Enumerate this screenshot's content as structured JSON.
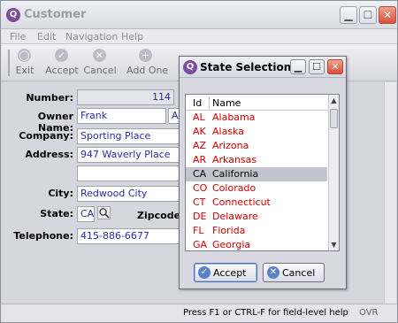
{
  "window": {
    "title": "Customer",
    "app_icon": "q-logo-icon",
    "controls": {
      "minimize_glyph": "▁",
      "maximize_glyph": "☐",
      "close_glyph": "✕"
    }
  },
  "menu": [
    "File",
    "Edit",
    "Navigation",
    "Help"
  ],
  "toolbar": [
    {
      "label": "Exit",
      "icon": "exit-icon",
      "glyph": "◯"
    },
    {
      "label": "Accept",
      "icon": "accept-icon",
      "glyph": "✓"
    },
    {
      "label": "Cancel",
      "icon": "cancel-icon",
      "glyph": "✕"
    },
    {
      "label": "Add One",
      "icon": "add-icon",
      "glyph": "+"
    }
  ],
  "form": {
    "number_label": "Number:",
    "number_value": "114",
    "owner_label": "Owner Name:",
    "owner_first": "Frank",
    "owner_last_initial": "A",
    "company_label": "Company:",
    "company_value": "Sporting Place",
    "address_label": "Address:",
    "address1_value": "947 Waverly Place",
    "address2_value": "",
    "city_label": "City:",
    "city_value": "Redwood City",
    "state_label": "State:",
    "state_value": "CA",
    "zipcode_label": "Zipcode:",
    "telephone_label": "Telephone:",
    "telephone_value": "415-886-6677"
  },
  "statusbar": {
    "help_text": "Press F1 or CTRL-F for field-level help",
    "mode": "OVR"
  },
  "dialog": {
    "title": "State Selection",
    "columns": {
      "id": "Id",
      "name": "Name"
    },
    "rows": [
      {
        "id": "AL",
        "name": "Alabama",
        "selected": false
      },
      {
        "id": "AK",
        "name": "Alaska",
        "selected": false
      },
      {
        "id": "AZ",
        "name": "Arizona",
        "selected": false
      },
      {
        "id": "AR",
        "name": "Arkansas",
        "selected": false
      },
      {
        "id": "CA",
        "name": "California",
        "selected": true
      },
      {
        "id": "CO",
        "name": "Colorado",
        "selected": false
      },
      {
        "id": "CT",
        "name": "Connecticut",
        "selected": false
      },
      {
        "id": "DE",
        "name": "Delaware",
        "selected": false
      },
      {
        "id": "FL",
        "name": "Florida",
        "selected": false
      },
      {
        "id": "GA",
        "name": "Georgia",
        "selected": false
      }
    ],
    "accept_label": "Accept",
    "cancel_label": "Cancel"
  },
  "colors": {
    "list_text": "#d40000",
    "field_text": "#2b2ba8",
    "selection": "#c4c4cf"
  }
}
